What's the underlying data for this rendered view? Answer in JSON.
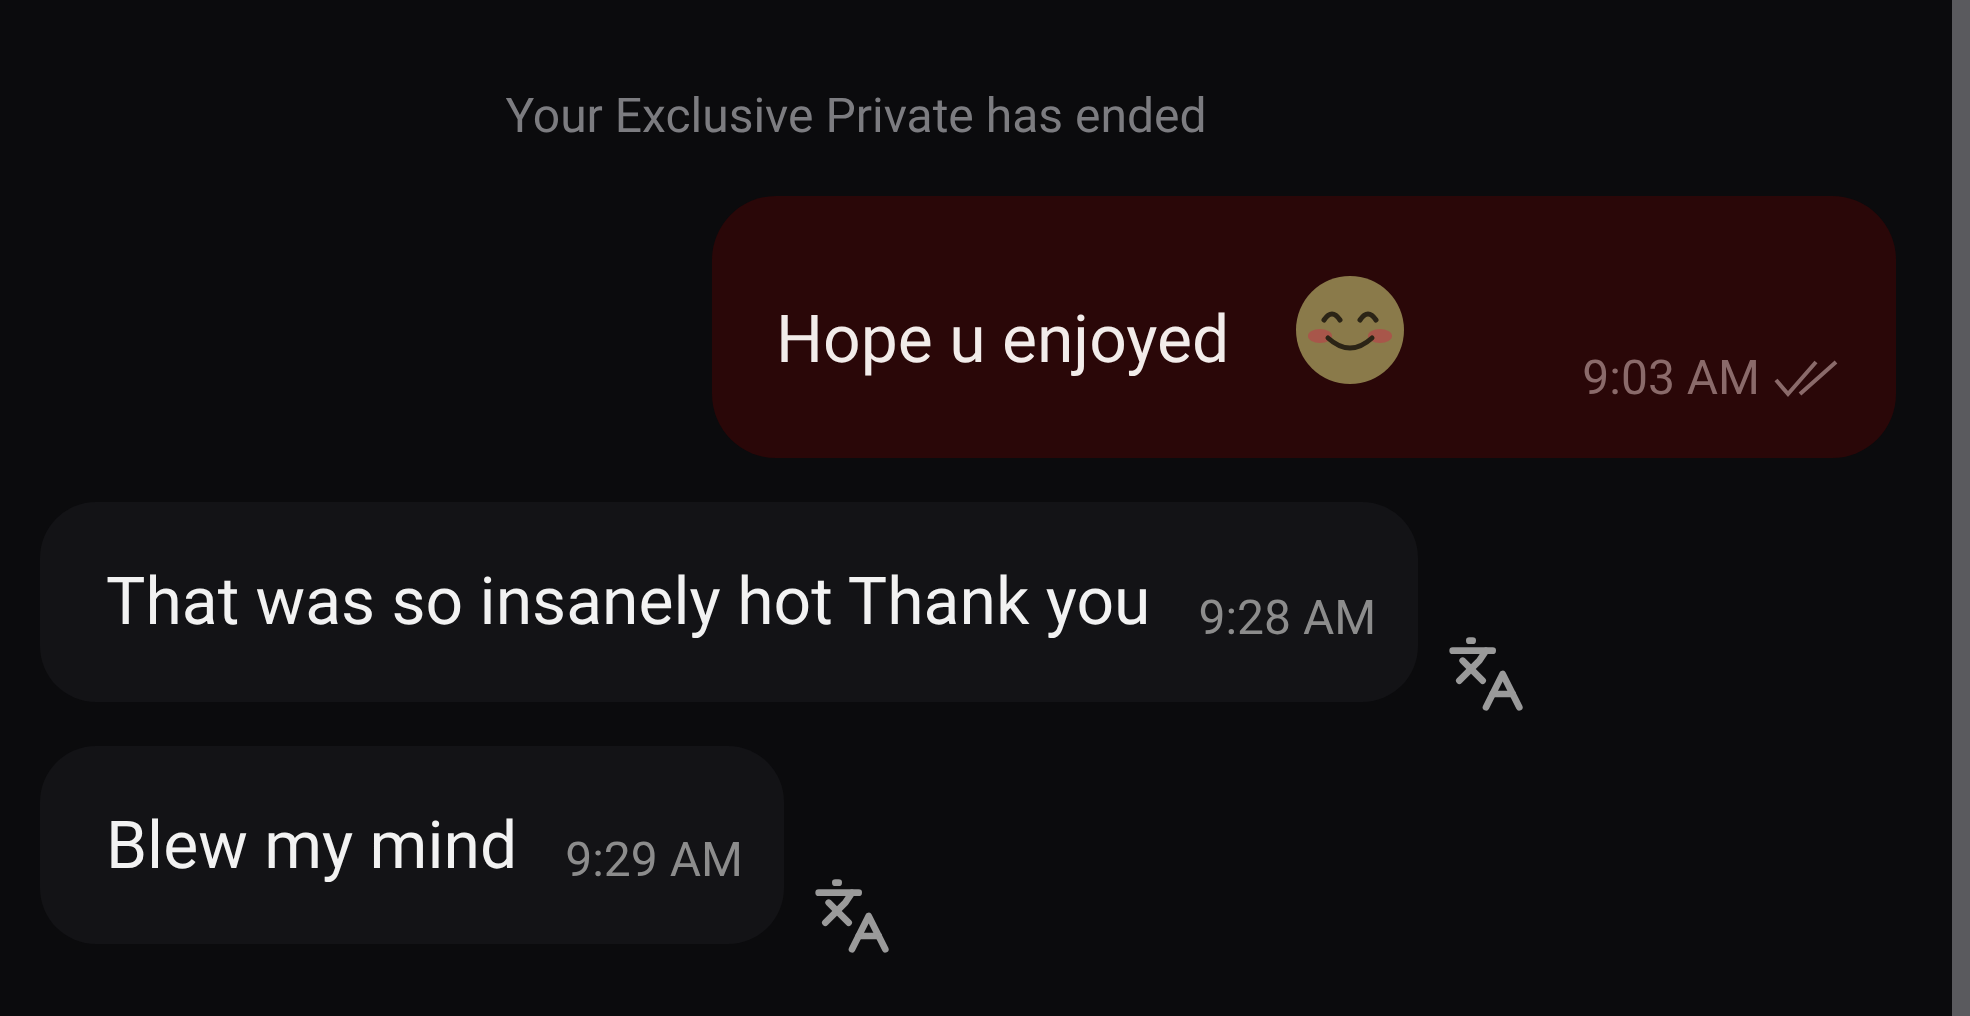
{
  "system_notice": "Your Exclusive Private has ended",
  "messages": [
    {
      "kind": "outgoing",
      "text": "Hope u enjoyed",
      "emoji": true,
      "time": "9:03 AM",
      "read": true
    },
    {
      "kind": "incoming",
      "text": "That was so insanely hot Thank you",
      "time": "9:28 AM"
    },
    {
      "kind": "incoming",
      "text": "Blew my mind",
      "time": "9:29 AM"
    }
  ]
}
